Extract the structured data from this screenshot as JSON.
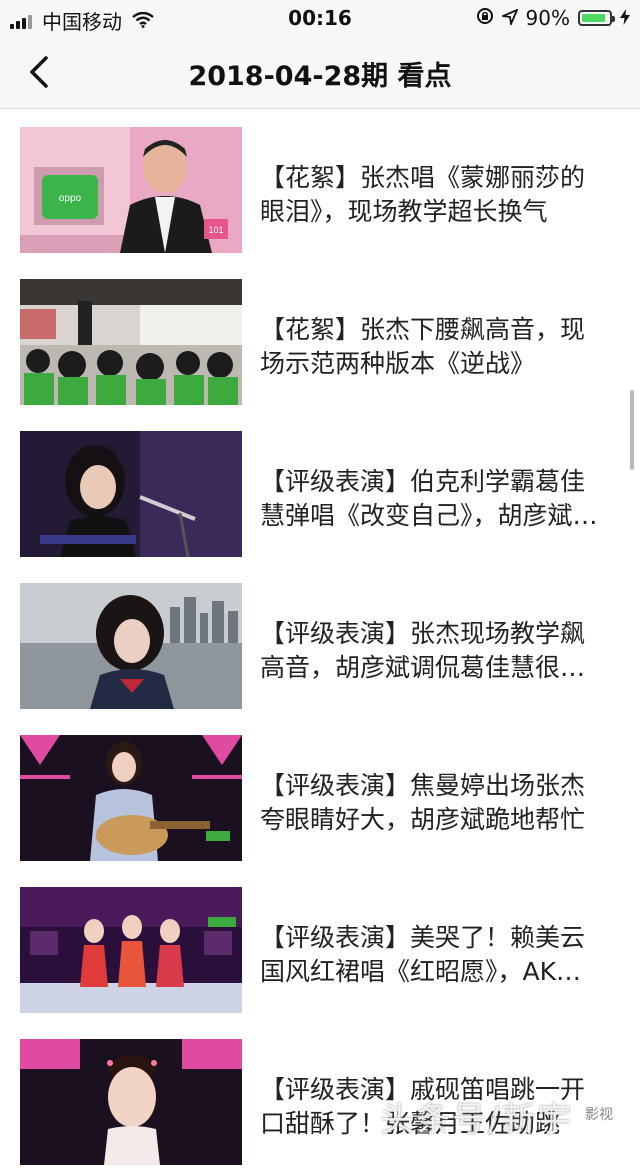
{
  "status_bar": {
    "carrier": "中国移动",
    "time": "00:16",
    "battery": "90%",
    "battery_level": 0.9
  },
  "nav": {
    "title": "2018-04-28期 看点"
  },
  "list": {
    "items": [
      {
        "title": "【花絮】张杰唱《蒙娜丽莎的眼泪》，现场教学超长换气"
      },
      {
        "title": "【花絮】张杰下腰飙高音，现场示范两种版本《逆战》"
      },
      {
        "title": "【评级表演】伯克利学霸葛佳慧弹唱《改变自己》，胡彦斌调侃"
      },
      {
        "title": "【评级表演】张杰现场教学飙高音，胡彦斌调侃葛佳慧很能唱"
      },
      {
        "title": "【评级表演】焦曼婷出场张杰夸眼睛好大，胡彦斌跪地帮忙"
      },
      {
        "title": "【评级表演】美哭了！赖美云国风红裙唱《红昭愿》，AK组合"
      },
      {
        "title": "【评级表演】戚砚笛唱跳一开口甜酥了！张馨月王佐助跳"
      }
    ]
  },
  "overlay": {
    "watermark": "头条号/新宇",
    "watermark_small": "影视"
  }
}
